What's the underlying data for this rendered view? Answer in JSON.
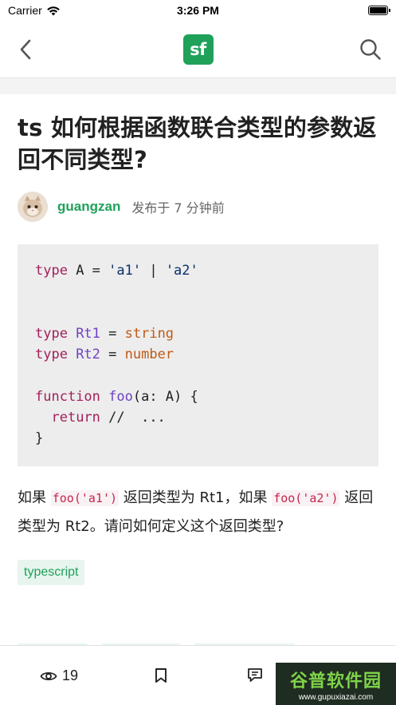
{
  "status_bar": {
    "carrier": "Carrier",
    "time": "3:26 PM"
  },
  "nav": {
    "logo_text": "sf"
  },
  "question": {
    "title": "ts 如何根据函数联合类型的参数返回不同类型?",
    "author": "guangzan",
    "publish_info": "发布于 7 分钟前",
    "code": {
      "line1": {
        "kw": "type",
        "rest": " A = ",
        "s1": "'a1'",
        "mid": " | ",
        "s2": "'a2'"
      },
      "line4": {
        "kw": "type",
        "name": " Rt1",
        "eq": " = ",
        "val": "string"
      },
      "line5": {
        "kw": "type",
        "name": " Rt2",
        "eq": " = ",
        "val": "number"
      },
      "line7": {
        "kw": "function",
        "name": " foo",
        "rest": "(a: A) {"
      },
      "line8": {
        "kw": "return",
        "rest": " //  ..."
      },
      "line9": "}"
    },
    "body": {
      "p1": "如果 ",
      "c1": "foo('a1')",
      "p2": " 返回类型为 Rt1，如果 ",
      "c2": "foo('a2')",
      "p3": " 返回类型为 Rt2。请问如何定义这个返回类型?"
    },
    "tags": [
      "typescript"
    ]
  },
  "toolbar": {
    "views": "19"
  },
  "watermark": {
    "main": "谷普软件园",
    "sub": "www.gupuxiazai.com"
  },
  "colors": {
    "brand_green": "#1fa15a",
    "keyword": "#a1215c",
    "type_name": "#6f42c1"
  }
}
